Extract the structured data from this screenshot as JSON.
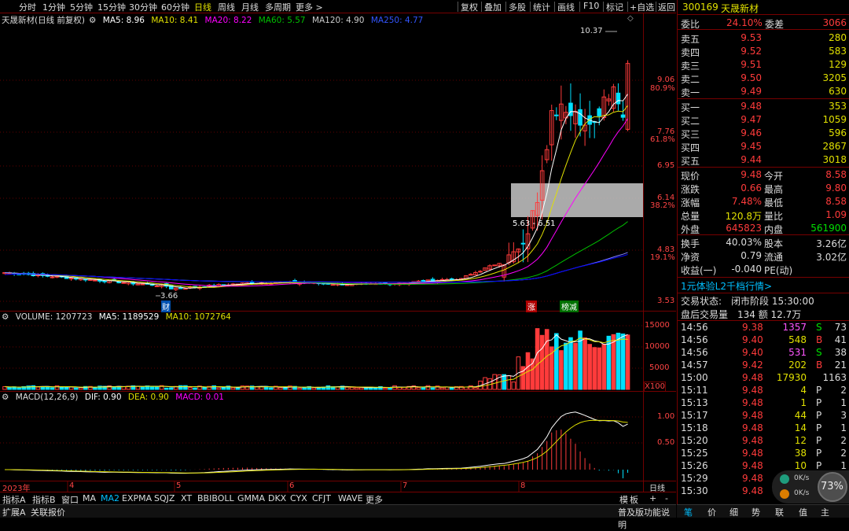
{
  "toolbar": {
    "periods": [
      "分时",
      "1分钟",
      "5分钟",
      "15分钟",
      "30分钟",
      "60分钟",
      "日线",
      "周线",
      "月线",
      "多周期",
      "更多 >"
    ],
    "active_period": "日线",
    "right_buttons": [
      "复权",
      "叠加",
      "多股",
      "统计",
      "画线",
      "F10",
      "标记",
      "+自选",
      "返回"
    ]
  },
  "main_legend": {
    "title": "天晟新材(日线 前复权)",
    "ma5": "MA5: 8.96",
    "ma10": "MA10: 8.41",
    "ma20": "MA20: 8.22",
    "ma60": "MA60: 5.57",
    "ma120": "MA120: 4.90",
    "ma250": "MA250: 4.77"
  },
  "price_axis": {
    "labels": [
      {
        "price": "9.06",
        "pct": "80.9%"
      },
      {
        "price": "7.76",
        "pct": "61.8%"
      },
      {
        "price": "6.95",
        "pct": ""
      },
      {
        "price": "6.14",
        "pct": "38.2%"
      },
      {
        "price": "4.83",
        "pct": "19.1%"
      },
      {
        "price": "3.53",
        "pct": ""
      }
    ]
  },
  "annotations": {
    "high": "10.37",
    "low": "3.66",
    "range": "5.63 - 6.51",
    "tag_zhang": "涨",
    "tag_bang": "榜减",
    "tag_cai": "财"
  },
  "volume_legend": {
    "title": "VOLUME: 1207723",
    "ma5": "MA5: 1189529",
    "ma10": "MA10: 1072764"
  },
  "volume_axis": [
    "15000",
    "10000",
    "5000"
  ],
  "volume_unit": "X100",
  "macd_legend": {
    "title": "MACD(12,26,9)",
    "dif": "DIF: 0.90",
    "dea": "DEA: 0.90",
    "macd": "MACD: 0.01"
  },
  "macd_axis": [
    "1.00",
    "0.50"
  ],
  "date_axis": {
    "labels": [
      "2023年",
      "4",
      "5",
      "6",
      "7",
      "8"
    ],
    "period_label": "日线"
  },
  "bottom_tabs": [
    "指标A",
    "指标B",
    "窗口",
    "MA",
    "MA2",
    "EXPMA",
    "SQJZ",
    "XT",
    "BBIBOLL",
    "GMMA",
    "DKX",
    "CYX",
    "CFJT",
    "WAVE",
    "更多"
  ],
  "active_bottom_tab": "MA2",
  "bottom_right": [
    "模",
    "板",
    "+",
    "-"
  ],
  "bottom_bar2": {
    "left": "扩展A",
    "left2": "关联报价",
    "right": "普及版功能说明"
  },
  "stock": {
    "code": "300169",
    "name": "天晟新材"
  },
  "weibi": {
    "label": "委比",
    "value": "24.10%",
    "label2": "委差",
    "value2": "3066"
  },
  "asks": [
    {
      "label": "卖五",
      "price": "9.53",
      "vol": "280"
    },
    {
      "label": "卖四",
      "price": "9.52",
      "vol": "583"
    },
    {
      "label": "卖三",
      "price": "9.51",
      "vol": "129"
    },
    {
      "label": "卖二",
      "price": "9.50",
      "vol": "3205"
    },
    {
      "label": "卖一",
      "price": "9.49",
      "vol": "630"
    }
  ],
  "bids": [
    {
      "label": "买一",
      "price": "9.48",
      "vol": "353"
    },
    {
      "label": "买二",
      "price": "9.47",
      "vol": "1059"
    },
    {
      "label": "买三",
      "price": "9.46",
      "vol": "596"
    },
    {
      "label": "买四",
      "price": "9.45",
      "vol": "2867"
    },
    {
      "label": "买五",
      "price": "9.44",
      "vol": "3018"
    }
  ],
  "quote": [
    {
      "l1": "现价",
      "v1": "9.48",
      "l2": "今开",
      "v2": "8.58"
    },
    {
      "l1": "涨跌",
      "v1": "0.66",
      "l2": "最高",
      "v2": "9.80"
    },
    {
      "l1": "涨幅",
      "v1": "7.48%",
      "l2": "最低",
      "v2": "8.58"
    },
    {
      "l1": "总量",
      "v1": "120.8万",
      "l2": "量比",
      "v2": "1.09"
    },
    {
      "l1": "外盘",
      "v1": "645823",
      "l2": "内盘",
      "v2": "561900"
    }
  ],
  "fund": [
    {
      "l1": "换手",
      "v1": "40.03%",
      "l2": "股本",
      "v2": "3.26亿"
    },
    {
      "l1": "净资",
      "v1": "0.79",
      "l2": "流通",
      "v2": "3.02亿"
    },
    {
      "l1": "收益(一)",
      "v1": "-0.040",
      "l2": "PE(动)",
      "v2": ""
    }
  ],
  "l2_promo": "1元体验L2千档行情>",
  "trade_status": {
    "l1": "交易状态:",
    "v1": "闭市阶段 15:30:00",
    "l2": "盘后交易量",
    "v2": "134 额 12.7万"
  },
  "ticks": [
    {
      "t": "14:56",
      "p": "9.38",
      "v": "1357",
      "d": "S",
      "n": "73"
    },
    {
      "t": "14:56",
      "p": "9.40",
      "v": "548",
      "d": "B",
      "n": "41"
    },
    {
      "t": "14:56",
      "p": "9.40",
      "v": "531",
      "d": "S",
      "n": "38"
    },
    {
      "t": "14:57",
      "p": "9.42",
      "v": "202",
      "d": "B",
      "n": "21"
    },
    {
      "t": "15:00",
      "p": "9.48",
      "v": "17930",
      "d": "",
      "n": "1163"
    },
    {
      "t": "15:11",
      "p": "9.48",
      "v": "4",
      "d": "P",
      "n": "2"
    },
    {
      "t": "15:13",
      "p": "9.48",
      "v": "1",
      "d": "P",
      "n": "1"
    },
    {
      "t": "15:17",
      "p": "9.48",
      "v": "44",
      "d": "P",
      "n": "3"
    },
    {
      "t": "15:18",
      "p": "9.48",
      "v": "14",
      "d": "P",
      "n": "1"
    },
    {
      "t": "15:20",
      "p": "9.48",
      "v": "12",
      "d": "P",
      "n": "2"
    },
    {
      "t": "15:25",
      "p": "9.48",
      "v": "38",
      "d": "P",
      "n": "2"
    },
    {
      "t": "15:26",
      "p": "9.48",
      "v": "10",
      "d": "P",
      "n": "1"
    },
    {
      "t": "15:29",
      "p": "9.48",
      "v": "",
      "d": "",
      "n": ""
    },
    {
      "t": "15:30",
      "p": "9.48",
      "v": "",
      "d": "",
      "n": ""
    }
  ],
  "net_widget": {
    "up": "0K/s",
    "down": "0K/s",
    "pct": "73%"
  },
  "right_tabs": [
    "笔",
    "价",
    "细",
    "势",
    "联",
    "值",
    "主"
  ],
  "colors": {
    "up": "#ff3b3b",
    "down": "#00e0ff",
    "ma5": "#ffffff",
    "ma10": "#e0e000",
    "ma20": "#ff00ff",
    "ma60": "#00c000",
    "ma120": "#8080ff",
    "ma250": "#0000ff",
    "frame": "#700000"
  }
}
